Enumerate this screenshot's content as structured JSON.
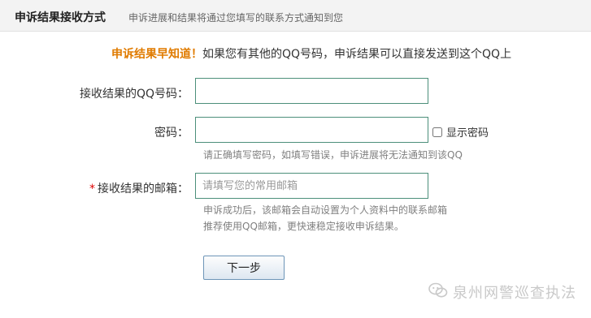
{
  "header": {
    "title": "申诉结果接收方式",
    "description": "申诉进展和结果将通过您填写的联系方式通知到您"
  },
  "notice": {
    "highlight": "申诉结果早知道！",
    "text": "如果您有其他的QQ号码，申诉结果可以直接发送到这个QQ上"
  },
  "form": {
    "qq_label": "接收结果的QQ号码：",
    "qq_value": "",
    "password_label": "密码：",
    "password_value": "",
    "show_password_label": "显示密码",
    "show_password_checked": false,
    "password_hint": "请正确填写密码，如填写错误，申诉进展将无法通知到该QQ",
    "email_required_mark": "*",
    "email_label": "接收结果的邮箱：",
    "email_placeholder": "请填写您的常用邮箱",
    "email_hint_1": "申诉成功后，该邮箱会自动设置为个人资料中的联系邮箱",
    "email_hint_2": "推荐使用QQ邮箱，更快速稳定接收申诉结果。",
    "next_label": "下一步"
  },
  "watermark": {
    "text": "泉州网警巡查执法",
    "icon": "wechat-icon"
  },
  "colors": {
    "highlight": "#e07b00",
    "required": "#dd0000",
    "input_border": "#4c8f7a",
    "header_bg": "#f3f3f3"
  }
}
